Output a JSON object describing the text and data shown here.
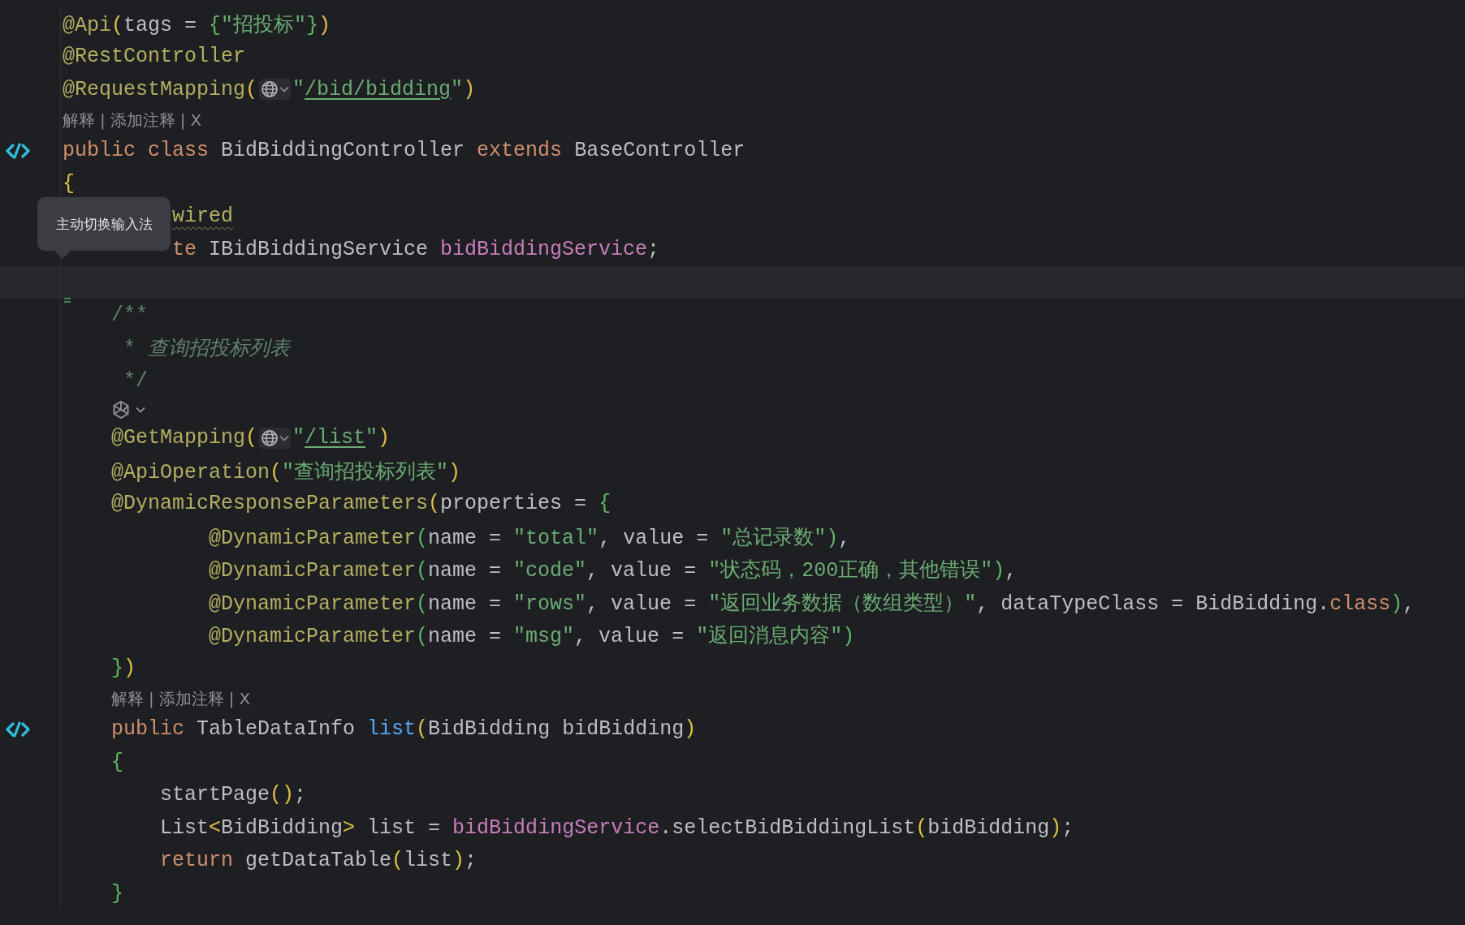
{
  "tooltip": {
    "text": "主动切换输入法"
  },
  "rows": [
    {
      "kind": "code",
      "tokens": [
        {
          "kind": "annotation",
          "text": "@Api"
        },
        {
          "kind": "bracket",
          "text": "("
        },
        {
          "kind": "plain",
          "text": "tags = "
        },
        {
          "kind": "bracket2",
          "text": "{"
        },
        {
          "kind": "string",
          "text": "\"招投标\""
        },
        {
          "kind": "bracket2",
          "text": "}"
        },
        {
          "kind": "bracket",
          "text": ")"
        }
      ]
    },
    {
      "kind": "code",
      "tokens": [
        {
          "kind": "annotation",
          "text": "@RestController"
        }
      ]
    },
    {
      "kind": "code",
      "tokens": [
        {
          "kind": "annotation",
          "text": "@RequestMapping"
        },
        {
          "kind": "bracket",
          "text": "("
        },
        {
          "kind": "globe"
        },
        {
          "kind": "string",
          "text": "\""
        },
        {
          "kind": "url",
          "text": "/bid/bidding"
        },
        {
          "kind": "string",
          "text": "\""
        },
        {
          "kind": "bracket",
          "text": ")"
        }
      ]
    },
    {
      "kind": "hint",
      "items": [
        "解释",
        "添加注释",
        "X"
      ],
      "separator": "|"
    },
    {
      "kind": "decl",
      "tokens": [
        {
          "kind": "keyword",
          "text": "public class "
        },
        {
          "kind": "plain",
          "text": "BidBiddingController "
        },
        {
          "kind": "keyword",
          "text": "extends "
        },
        {
          "kind": "plain",
          "text": "BaseController"
        }
      ]
    },
    {
      "kind": "code",
      "tokens": [
        {
          "kind": "bracket",
          "text": "{"
        }
      ],
      "children": [
        {
          "kind": "covered",
          "tokens": [
            {
              "kind": "warning",
              "text": "wired"
            }
          ]
        },
        {
          "kind": "covered",
          "tokens": [
            {
              "kind": "keyword",
              "text": "te "
            },
            {
              "kind": "plain",
              "text": "IBidBiddingService "
            },
            {
              "kind": "field",
              "text": "bidBiddingService"
            },
            {
              "kind": "plain",
              "text": ";"
            }
          ]
        },
        {
          "kind": "current_line"
        },
        {
          "kind": "code",
          "tokens": [
            {
              "kind": "doc",
              "text": "/**"
            }
          ]
        },
        {
          "kind": "doc_body",
          "tokens": [
            {
              "kind": "doc",
              "text": "* "
            },
            {
              "kind": "doc_italic",
              "text": "查询招投标列表"
            }
          ]
        },
        {
          "kind": "doc_body",
          "tokens": [
            {
              "kind": "doc",
              "text": "*/"
            }
          ]
        },
        {
          "kind": "inlay"
        },
        {
          "kind": "code",
          "tokens": [
            {
              "kind": "annotation",
              "text": "@GetMapping"
            },
            {
              "kind": "bracket",
              "text": "("
            },
            {
              "kind": "globe"
            },
            {
              "kind": "string",
              "text": "\""
            },
            {
              "kind": "url",
              "text": "/list"
            },
            {
              "kind": "string",
              "text": "\""
            },
            {
              "kind": "bracket",
              "text": ")"
            }
          ]
        },
        {
          "kind": "code",
          "tokens": [
            {
              "kind": "annotation",
              "text": "@ApiOperation"
            },
            {
              "kind": "bracket",
              "text": "("
            },
            {
              "kind": "string",
              "text": "\"查询招投标列表\""
            },
            {
              "kind": "bracket",
              "text": ")"
            }
          ]
        },
        {
          "kind": "code",
          "tokens": [
            {
              "kind": "annotation",
              "text": "@DynamicResponseParameters"
            },
            {
              "kind": "bracket",
              "text": "("
            },
            {
              "kind": "plain",
              "text": "properties = "
            },
            {
              "kind": "bracket2",
              "text": "{"
            }
          ],
          "children": [
            {
              "kind": "param",
              "tokens": [
                {
                  "kind": "annotation",
                  "text": "@DynamicParameter"
                },
                {
                  "kind": "bracket2",
                  "text": "("
                },
                {
                  "kind": "plain",
                  "text": "name = "
                },
                {
                  "kind": "string",
                  "text": "\"total\""
                },
                {
                  "kind": "plain",
                  "text": ", value = "
                },
                {
                  "kind": "string",
                  "text": "\"总记录数\""
                },
                {
                  "kind": "bracket2",
                  "text": ")"
                },
                {
                  "kind": "plain",
                  "text": ","
                }
              ]
            },
            {
              "kind": "param",
              "tokens": [
                {
                  "kind": "annotation",
                  "text": "@DynamicParameter"
                },
                {
                  "kind": "bracket2",
                  "text": "("
                },
                {
                  "kind": "plain",
                  "text": "name = "
                },
                {
                  "kind": "string",
                  "text": "\"code\""
                },
                {
                  "kind": "plain",
                  "text": ", value = "
                },
                {
                  "kind": "string",
                  "text": "\"状态码，200正确，其他错误\""
                },
                {
                  "kind": "bracket2",
                  "text": ")"
                },
                {
                  "kind": "plain",
                  "text": ","
                }
              ]
            },
            {
              "kind": "param",
              "tokens": [
                {
                  "kind": "annotation",
                  "text": "@DynamicParameter"
                },
                {
                  "kind": "bracket2",
                  "text": "("
                },
                {
                  "kind": "plain",
                  "text": "name = "
                },
                {
                  "kind": "string",
                  "text": "\"rows\""
                },
                {
                  "kind": "plain",
                  "text": ", value = "
                },
                {
                  "kind": "string",
                  "text": "\"返回业务数据（数组类型）\""
                },
                {
                  "kind": "plain",
                  "text": ", dataTypeClass = BidBidding."
                },
                {
                  "kind": "keyword",
                  "text": "class"
                },
                {
                  "kind": "bracket2",
                  "text": ")"
                },
                {
                  "kind": "plain",
                  "text": ","
                }
              ]
            },
            {
              "kind": "param",
              "tokens": [
                {
                  "kind": "annotation",
                  "text": "@DynamicParameter"
                },
                {
                  "kind": "bracket2",
                  "text": "("
                },
                {
                  "kind": "plain",
                  "text": "name = "
                },
                {
                  "kind": "string",
                  "text": "\"msg\""
                },
                {
                  "kind": "plain",
                  "text": ", value = "
                },
                {
                  "kind": "string",
                  "text": "\"返回消息内容\""
                },
                {
                  "kind": "bracket2",
                  "text": ")"
                }
              ]
            }
          ]
        },
        {
          "kind": "code",
          "tokens": [
            {
              "kind": "bracket2",
              "text": "}"
            },
            {
              "kind": "bracket",
              "text": ")"
            }
          ]
        },
        {
          "kind": "hint",
          "items": [
            "解释",
            "添加注释",
            "X"
          ],
          "separator": "|"
        },
        {
          "kind": "decl",
          "tokens": [
            {
              "kind": "keyword",
              "text": "public "
            },
            {
              "kind": "plain",
              "text": "TableDataInfo "
            },
            {
              "kind": "method",
              "text": "list"
            },
            {
              "kind": "bracket",
              "text": "("
            },
            {
              "kind": "plain",
              "text": "BidBidding bidBidding"
            },
            {
              "kind": "bracket",
              "text": ")"
            }
          ]
        },
        {
          "kind": "code",
          "tokens": [
            {
              "kind": "bracket2",
              "text": "{"
            }
          ],
          "children": [
            {
              "kind": "code",
              "tokens": [
                {
                  "kind": "plain",
                  "text": "startPage"
                },
                {
                  "kind": "bracket",
                  "text": "()"
                },
                {
                  "kind": "plain",
                  "text": ";"
                }
              ]
            },
            {
              "kind": "code",
              "tokens": [
                {
                  "kind": "plain",
                  "text": "List"
                },
                {
                  "kind": "bracket",
                  "text": "<"
                },
                {
                  "kind": "plain",
                  "text": "BidBidding"
                },
                {
                  "kind": "bracket",
                  "text": ">"
                },
                {
                  "kind": "plain",
                  "text": " list = "
                },
                {
                  "kind": "field",
                  "text": "bidBiddingService"
                },
                {
                  "kind": "plain",
                  "text": ".selectBidBiddingList"
                },
                {
                  "kind": "bracket",
                  "text": "("
                },
                {
                  "kind": "plain",
                  "text": "bidBidding"
                },
                {
                  "kind": "bracket",
                  "text": ")"
                },
                {
                  "kind": "plain",
                  "text": ";"
                }
              ]
            },
            {
              "kind": "code",
              "tokens": [
                {
                  "kind": "keyword",
                  "text": "return "
                },
                {
                  "kind": "plain",
                  "text": "getDataTable"
                },
                {
                  "kind": "bracket",
                  "text": "("
                },
                {
                  "kind": "plain",
                  "text": "list"
                },
                {
                  "kind": "bracket",
                  "text": ")"
                },
                {
                  "kind": "plain",
                  "text": ";"
                }
              ]
            }
          ]
        },
        {
          "kind": "code",
          "tokens": [
            {
              "kind": "bracket2",
              "text": "}"
            }
          ]
        }
      ]
    }
  ]
}
